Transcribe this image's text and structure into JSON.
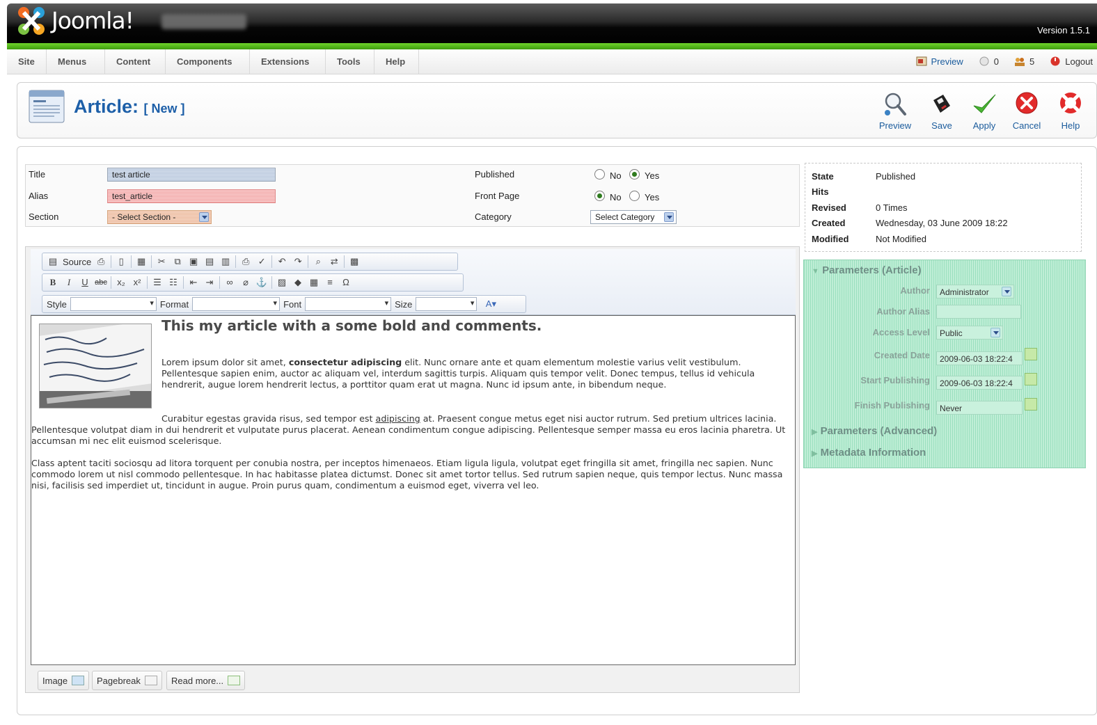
{
  "header": {
    "logo_text": "Joomla!",
    "version": "Version 1.5.1"
  },
  "menu": [
    {
      "label": "Site"
    },
    {
      "label": "Menus"
    },
    {
      "label": "Content"
    },
    {
      "label": "Components"
    },
    {
      "label": "Extensions"
    },
    {
      "label": "Tools"
    },
    {
      "label": "Help"
    }
  ],
  "status": {
    "preview": "Preview",
    "messages_count": "0",
    "users_count": "5",
    "logout": "Logout"
  },
  "page": {
    "title": "Article:",
    "subtitle": "[ New ]"
  },
  "toolbar": {
    "preview": "Preview",
    "save": "Save",
    "apply": "Apply",
    "cancel": "Cancel",
    "help": "Help"
  },
  "form": {
    "title_label": "Title",
    "title_value": "test article",
    "alias_label": "Alias",
    "alias_value": "test_article",
    "section_label": "Section",
    "section_value": "- Select Section -",
    "published_label": "Published",
    "frontpage_label": "Front Page",
    "category_label": "Category",
    "category_value": "Select Category",
    "no": "No",
    "yes": "Yes",
    "published_selected": "Yes",
    "frontpage_selected": "No"
  },
  "info": {
    "state_label": "State",
    "state_value": "Published",
    "hits_label": "Hits",
    "revised_label": "Revised",
    "revised_value": "0 Times",
    "created_label": "Created",
    "created_value": "Wednesday, 03 June 2009 18:22",
    "modified_label": "Modified",
    "modified_value": "Not Modified"
  },
  "params": {
    "article_head": "Parameters (Article)",
    "author_label": "Author",
    "author_value": "Administrator",
    "author_alias_label": "Author Alias",
    "access_label": "Access Level",
    "access_value": "Public",
    "created_date_label": "Created Date",
    "created_date_value": "2009-06-03 18:22:4",
    "start_pub_label": "Start Publishing",
    "start_pub_value": "2009-06-03 18:22:4",
    "finish_pub_label": "Finish Publishing",
    "finish_pub_value": "Never",
    "advanced_head": "Parameters (Advanced)",
    "metadata_head": "Metadata Information"
  },
  "editor_toolbar": {
    "source": "Source",
    "style": "Style",
    "format": "Format",
    "font": "Font",
    "size": "Size"
  },
  "article": {
    "heading": "This my article with a some bold and comments.",
    "p1_a": "Lorem ipsum dolor sit amet, ",
    "p1_bold": "consectetur adipiscing",
    "p1_b": " elit. Nunc ornare ante et quam elementum molestie varius velit vestibulum. Pellentesque sapien enim, auctor ac aliquam vel, interdum sagittis turpis. Aliquam quis tempor velit. Donec tempus, tellus id vehicula hendrerit, augue lorem hendrerit lectus, a porttitor quam erat ut magna. Nunc id ipsum ante, in bibendum neque.",
    "p2_a": "Curabitur egestas gravida risus, sed tempor est ",
    "p2_link": "adipiscing",
    "p2_b": " at. Praesent congue metus eget nisi auctor rutrum. Sed pretium ultrices lacinia. Pellentesque volutpat diam in dui hendrerit et vulputate purus placerat. Aenean condimentum congue adipiscing. Pellentesque semper massa eu eros lacinia pharetra. Ut accumsan mi nec elit euismod scelerisque.",
    "p3": "Class aptent taciti sociosqu ad litora torquent per conubia nostra, per inceptos himenaeos. Etiam ligula ligula, volutpat eget fringilla sit amet, fringilla nec sapien. Nunc commodo lorem ut nisl commodo pellentesque. In hac habitasse platea dictumst. Donec sit amet tortor tellus. Sed rutrum sapien neque, quis tempor lectus. Nunc massa nisi, facilisis sed imperdiet ut, tincidunt in augue. Proin purus quam, condimentum a euismod eget, viverra vel leo."
  },
  "editor_buttons": {
    "image": "Image",
    "pagebreak": "Pagebreak",
    "readmore": "Read more..."
  },
  "colors": {
    "accent_blue": "#1d5fa8",
    "joomla_green": "#6ed42a",
    "params_green": "#b9ebd2"
  }
}
